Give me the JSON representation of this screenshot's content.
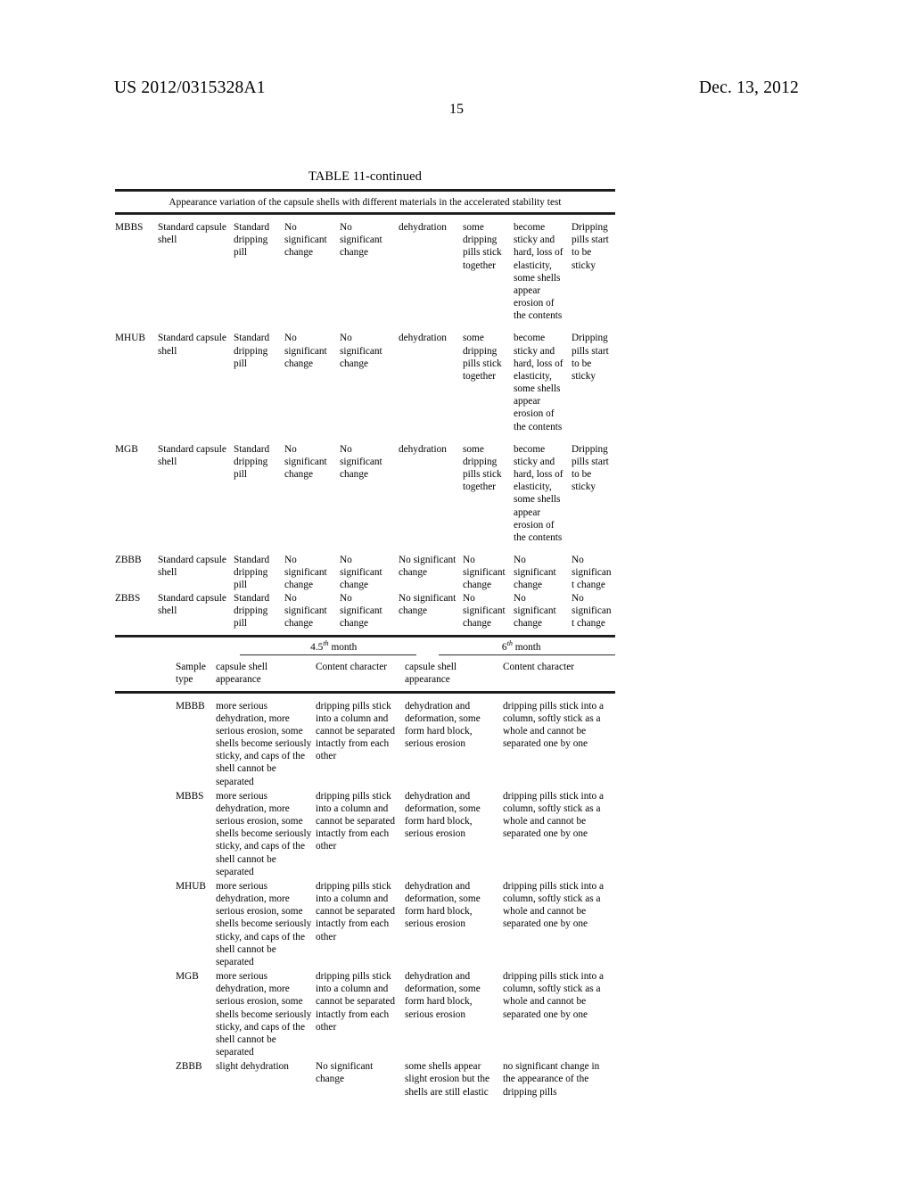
{
  "page": {
    "publication_number": "US 2012/0315328A1",
    "publication_date": "Dec. 13, 2012",
    "page_number": "15"
  },
  "table": {
    "caption": "TABLE 11-continued",
    "subcaption": "Appearance variation of the capsule shells with different materials in the accelerated stability test",
    "section1": {
      "rows": [
        {
          "sample": "MBBS",
          "cells": [
            "Standard capsule shell",
            "Standard dripping pill",
            "No significant change",
            "No significant change",
            "dehydration",
            "some dripping pills stick together",
            "become sticky and hard, loss of elasticity, some shells appear erosion of the contents",
            "Dripping pills start to be sticky"
          ]
        },
        {
          "sample": "MHUB",
          "cells": [
            "Standard capsule shell",
            "Standard dripping pill",
            "No significant change",
            "No significant change",
            "dehydration",
            "some dripping pills stick together",
            "become sticky and hard, loss of elasticity, some shells appear erosion of the contents",
            "Dripping pills start to be sticky"
          ]
        },
        {
          "sample": "MGB",
          "cells": [
            "Standard capsule shell",
            "Standard dripping pill",
            "No significant change",
            "No significant change",
            "dehydration",
            "some dripping pills stick together",
            "become sticky and hard, loss of elasticity, some shells appear erosion of the contents",
            "Dripping pills start to be sticky"
          ]
        },
        {
          "sample": "ZBBB",
          "cells": [
            "Standard capsule shell",
            "Standard dripping pill",
            "No significant change",
            "No significant change",
            "No significant change",
            "No significant change",
            "No significant change",
            "No significant change"
          ]
        },
        {
          "sample": "ZBBS",
          "cells": [
            "Standard capsule shell",
            "Standard dripping pill",
            "No significant change",
            "No significant change",
            "No significant change",
            "No significant change",
            "No significant change",
            "No significant change"
          ]
        }
      ]
    },
    "section2": {
      "month_groups": [
        {
          "value": "4.5",
          "ordinal": "th",
          "unit": " month"
        },
        {
          "value": "6",
          "ordinal": "th",
          "unit": " month"
        }
      ],
      "headers": [
        "Sample type",
        "capsule shell appearance",
        "Content character",
        "capsule shell appearance",
        "Content character"
      ],
      "rows": [
        {
          "sample": "MBBB",
          "cells": [
            "more serious dehydration, more serious erosion, some shells become seriously sticky, and caps of the shell cannot be separated",
            "dripping pills stick into a column and cannot be separated intactly from each other",
            "dehydration and deformation, some form hard block, serious erosion",
            "dripping pills stick into a column, softly stick as a whole and cannot be separated one by one"
          ]
        },
        {
          "sample": "MBBS",
          "cells": [
            "more serious dehydration, more serious erosion, some shells become seriously sticky, and caps of the shell cannot be separated",
            "dripping pills stick into a column and cannot be separated intactly from each other",
            "dehydration and deformation, some form hard block, serious erosion",
            "dripping pills stick into a column, softly stick as a whole and cannot be separated one by one"
          ]
        },
        {
          "sample": "MHUB",
          "cells": [
            "more serious dehydration, more serious erosion, some shells become seriously sticky, and caps of the shell cannot be separated",
            "dripping pills stick into a column and cannot be separated intactly from each other",
            "dehydration and deformation, some form hard block, serious erosion",
            "dripping pills stick into a column, softly stick as a whole and cannot be separated one by one"
          ]
        },
        {
          "sample": "MGB",
          "cells": [
            "more serious dehydration, more serious erosion, some shells become seriously sticky, and caps of the shell cannot be separated",
            "dripping pills stick into a column and cannot be separated intactly from each other",
            "dehydration and deformation, some form hard block, serious erosion",
            "dripping pills stick into a column, softly stick as a whole and cannot be separated one by one"
          ]
        },
        {
          "sample": "ZBBB",
          "cells": [
            "slight dehydration",
            "No significant change",
            "some shells appear slight erosion but the shells are still elastic",
            "no significant change in the appearance of the dripping pills"
          ]
        }
      ]
    }
  }
}
